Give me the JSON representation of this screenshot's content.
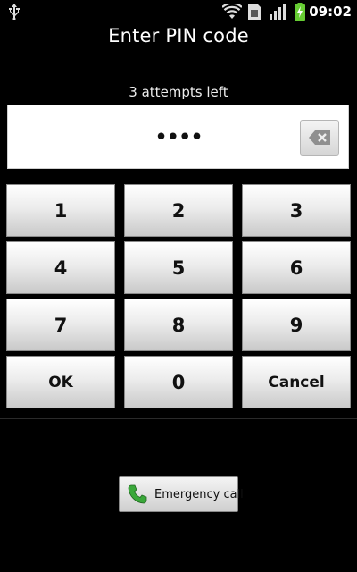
{
  "status_bar": {
    "time": "09:02",
    "icons": [
      "usb-icon",
      "wifi-icon",
      "sim-icon",
      "signal-icon",
      "battery-charging-icon"
    ]
  },
  "screen": {
    "title": "Enter PIN code",
    "attempts_text": "3 attempts left",
    "pin_masked": "••••"
  },
  "keypad": {
    "keys": [
      "1",
      "2",
      "3",
      "4",
      "5",
      "6",
      "7",
      "8",
      "9",
      "OK",
      "0",
      "Cancel"
    ]
  },
  "emergency": {
    "label": "Emergency call"
  },
  "colors": {
    "background": "#000000",
    "phone_icon": "#3aa83a",
    "battery": "#66cc33"
  }
}
